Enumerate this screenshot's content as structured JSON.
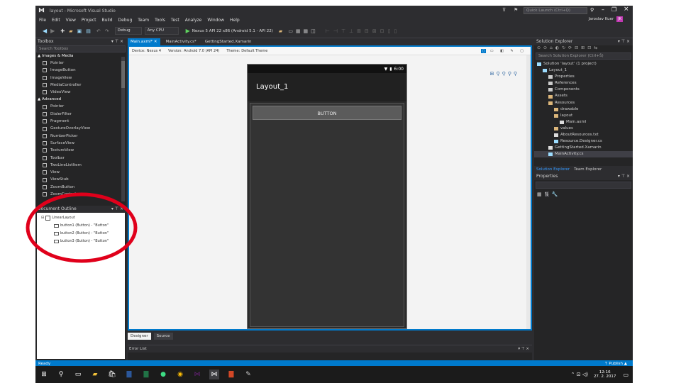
{
  "window": {
    "title": "layout - Microsoft Visual Studio",
    "quick_launch_placeholder": "Quick Launch (Ctrl+Q)",
    "user": "Jaroslav Kuer",
    "user_initials": "JK"
  },
  "menu": [
    "File",
    "Edit",
    "View",
    "Project",
    "Build",
    "Debug",
    "Team",
    "Tools",
    "Test",
    "Analyze",
    "Window",
    "Help"
  ],
  "toolbar": {
    "config": "Debug",
    "platform": "Any CPU",
    "run_target": "Nexus 5 API 22 x86 (Android 5.1 - API 22)"
  },
  "toolbox": {
    "title": "Toolbox",
    "search_placeholder": "Search Toolbox",
    "categories": [
      {
        "name": "▲ Images & Media",
        "items": [
          "Pointer",
          "ImageButton",
          "ImageView",
          "MediaController",
          "VideoView"
        ]
      },
      {
        "name": "▲ Advanced",
        "items": [
          "Pointer",
          "DialerFilter",
          "Fragment",
          "GestureOverlayView",
          "NumberPicker",
          "SurfaceView",
          "TextureView",
          "Toolbar",
          "TwoLineListItem",
          "View",
          "ViewStub",
          "ZoomButton",
          "ZoomControls"
        ]
      }
    ]
  },
  "outline": {
    "title": "Document Outline",
    "root": "LinearLayout",
    "items": [
      "button1 (Button) - \"Button\"",
      "button2 (Button) - \"Button\"",
      "button3 (Button) - \"Button\""
    ]
  },
  "tabs": [
    "Main.axml*",
    "MainActivity.cs*",
    "GettingStarted.Xamarin"
  ],
  "designer": {
    "device_label": "Device:",
    "device": "Nexus 4",
    "version_label": "Version:",
    "version": "Android 7.0 (API 24)",
    "theme_label": "Theme:",
    "theme": "Default Theme",
    "status_time": "6:00",
    "app_title": "Layout_1",
    "button_text": "BUTTON",
    "bottom_tabs": [
      "Designer",
      "Source"
    ]
  },
  "error_list": {
    "title": "Error List"
  },
  "solution_explorer": {
    "title": "Solution Explorer",
    "search_placeholder": "Search Solution Explorer (Ctrl+Š)",
    "items": [
      {
        "text": "Solution 'layout' (1 project)",
        "indent": 0,
        "icon": "solution"
      },
      {
        "text": "Layout_1",
        "indent": 1,
        "icon": "project"
      },
      {
        "text": "Properties",
        "indent": 2,
        "icon": "wrench"
      },
      {
        "text": "References",
        "indent": 2,
        "icon": "refs"
      },
      {
        "text": "Components",
        "indent": 2,
        "icon": "components"
      },
      {
        "text": "Assets",
        "indent": 2,
        "icon": "folder"
      },
      {
        "text": "Resources",
        "indent": 2,
        "icon": "folder"
      },
      {
        "text": "drawable",
        "indent": 3,
        "icon": "folder"
      },
      {
        "text": "layout",
        "indent": 3,
        "icon": "folder"
      },
      {
        "text": "Main.axml",
        "indent": 4,
        "icon": "file"
      },
      {
        "text": "values",
        "indent": 3,
        "icon": "folder"
      },
      {
        "text": "AboutResources.txt",
        "indent": 3,
        "icon": "file"
      },
      {
        "text": "Resource.Designer.cs",
        "indent": 3,
        "icon": "cs"
      },
      {
        "text": "GettingStarted.Xamarin",
        "indent": 2,
        "icon": "file"
      },
      {
        "text": "MainActivity.cs",
        "indent": 2,
        "icon": "cs",
        "selected": true
      }
    ],
    "bottom_tabs": [
      "Solution Explorer",
      "Team Explorer"
    ]
  },
  "properties": {
    "title": "Properties"
  },
  "status": {
    "left": "Ready",
    "right": "↑ Publish ▲"
  },
  "taskbar": {
    "time": "12:16",
    "date": "27. 2. 2017"
  },
  "colors": {
    "accent": "#007acc",
    "annotation": "#e0001b"
  }
}
